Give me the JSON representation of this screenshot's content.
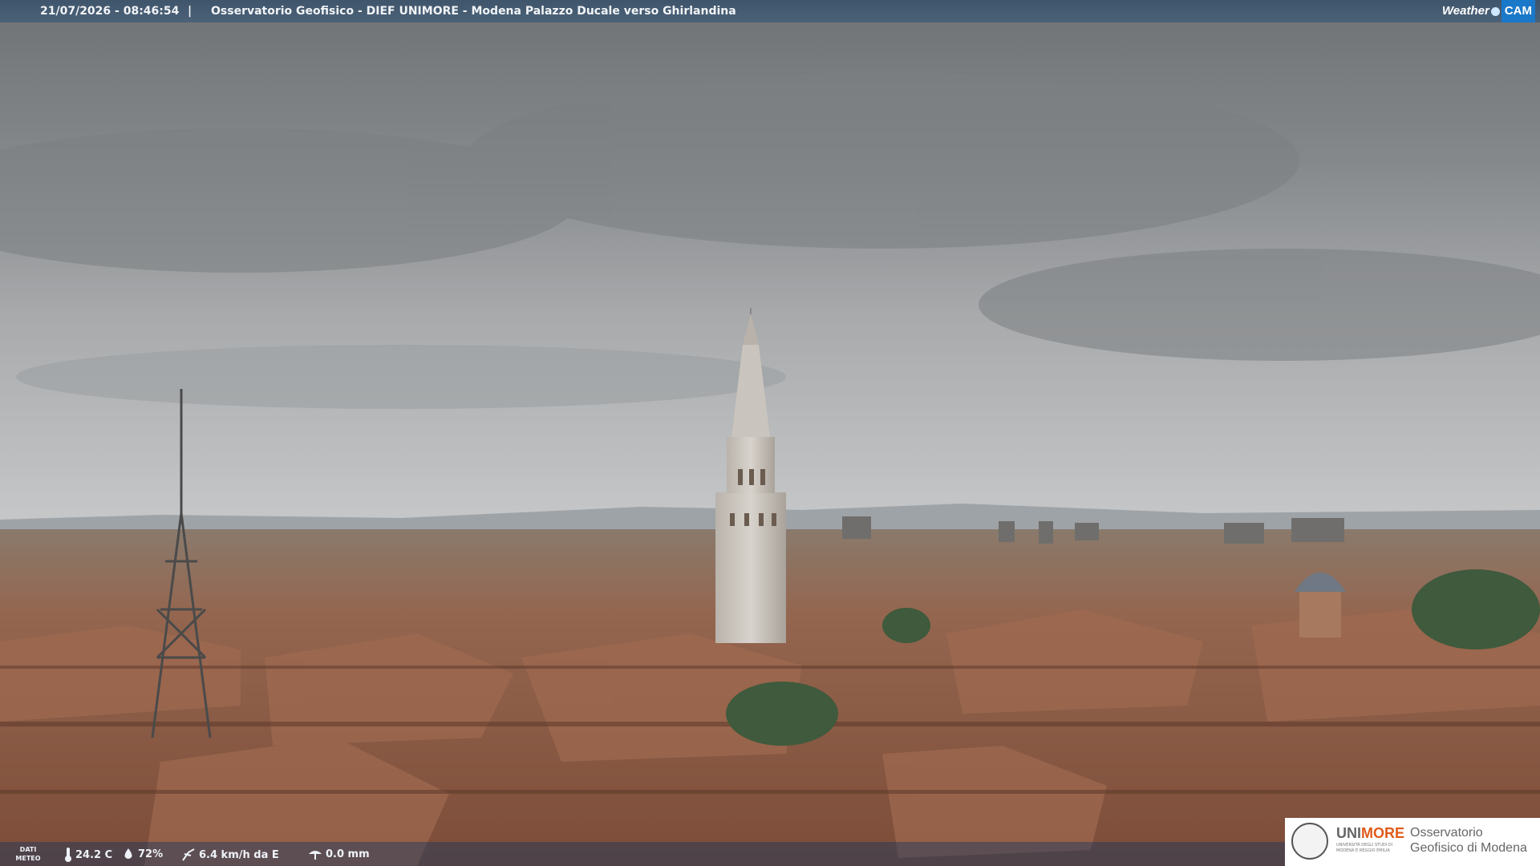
{
  "header": {
    "datetime": "21/07/2026 - 08:46:54",
    "separator": "|",
    "title": "Osservatorio Geofisico - DIEF UNIMORE - Modena Palazzo Ducale verso Ghirlandina",
    "brand_weather": "Weather",
    "brand_cam": "CAM"
  },
  "weather": {
    "label": "DATI METEO",
    "temperature": "24.2 C",
    "humidity": "72%",
    "wind": "6.4 km/h da E",
    "rain": "0.0 mm",
    "icons": [
      "thermometer-icon",
      "humidity-icon",
      "wind-icon",
      "rain-icon"
    ]
  },
  "logo": {
    "name_part1": "UNI",
    "name_part2": "MORE",
    "subtitle": "UNIVERSITÀ DEGLI STUDI DI MODENA E REGGIO EMILIA",
    "observatory": "Osservatorio Geofisico di Modena"
  },
  "colors": {
    "header_bar": "#455b71",
    "sky": "#9a9c9e",
    "roofs": "#8a5a44",
    "brand_accent": "#e05a1a"
  }
}
